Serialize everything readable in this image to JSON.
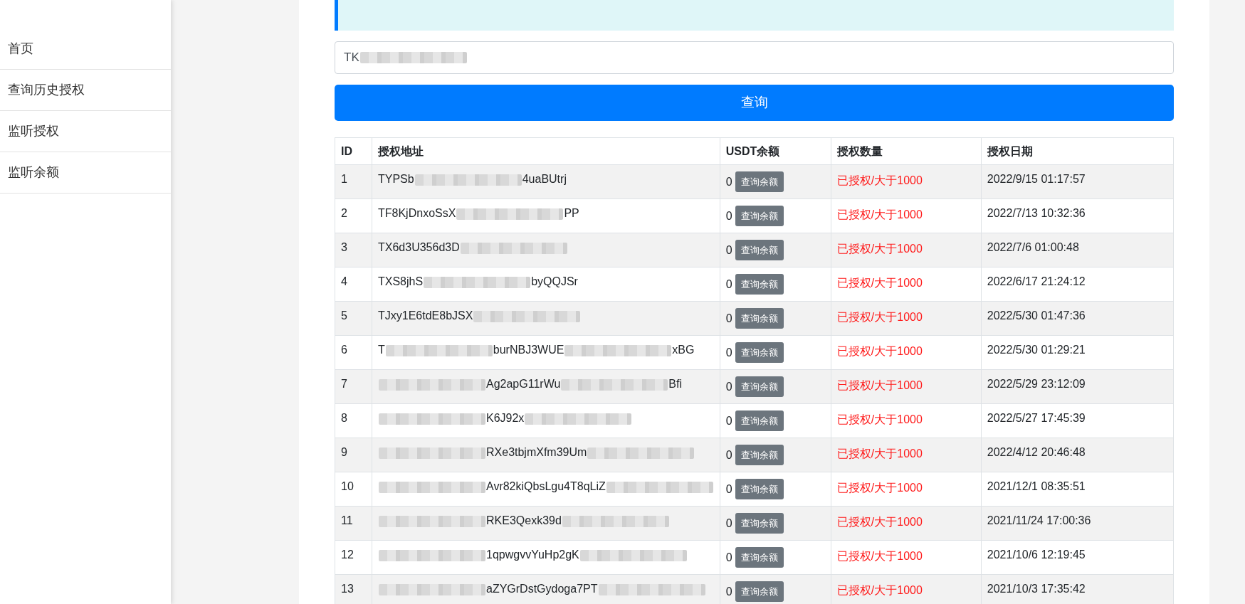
{
  "sidebar": {
    "items": [
      {
        "label": "首页"
      },
      {
        "label": "查询历史授权"
      },
      {
        "label": "监听授权"
      },
      {
        "label": "监听余额"
      }
    ]
  },
  "search": {
    "value": [
      {
        "kind": "text",
        "text": "TK"
      },
      {
        "kind": "blur"
      }
    ]
  },
  "query_button": "查询",
  "table": {
    "columns": [
      "ID",
      "授权地址",
      "USDT余额",
      "授权数量",
      "授权日期"
    ],
    "rows": [
      {
        "id": "1",
        "address": [
          {
            "kind": "text",
            "text": "TYPSb"
          },
          {
            "kind": "blur"
          },
          {
            "kind": "text",
            "text": "4uaBUtrj"
          }
        ],
        "balance": "0",
        "button": "查询余额",
        "amount": "已授权/大于1000",
        "date": "2022/9/15 01:17:57"
      },
      {
        "id": "2",
        "address": [
          {
            "kind": "text",
            "text": "TF8KjDnxoSsX"
          },
          {
            "kind": "blur"
          },
          {
            "kind": "text",
            "text": "PP"
          }
        ],
        "balance": "0",
        "button": "查询余额",
        "amount": "已授权/大于1000",
        "date": "2022/7/13 10:32:36"
      },
      {
        "id": "3",
        "address": [
          {
            "kind": "text",
            "text": "TX6d3U356d3D"
          },
          {
            "kind": "blur"
          }
        ],
        "balance": "0",
        "button": "查询余额",
        "amount": "已授权/大于1000",
        "date": "2022/7/6 01:00:48"
      },
      {
        "id": "4",
        "address": [
          {
            "kind": "text",
            "text": "TXS8jhS"
          },
          {
            "kind": "blur"
          },
          {
            "kind": "text",
            "text": "byQQJSr"
          }
        ],
        "balance": "0",
        "button": "查询余额",
        "amount": "已授权/大于1000",
        "date": "2022/6/17 21:24:12"
      },
      {
        "id": "5",
        "address": [
          {
            "kind": "text",
            "text": "TJxy1E6tdE8bJSX"
          },
          {
            "kind": "blur"
          }
        ],
        "balance": "0",
        "button": "查询余额",
        "amount": "已授权/大于1000",
        "date": "2022/5/30 01:47:36"
      },
      {
        "id": "6",
        "address": [
          {
            "kind": "text",
            "text": "T"
          },
          {
            "kind": "blur"
          },
          {
            "kind": "text",
            "text": "burNBJ3WUE"
          },
          {
            "kind": "blur"
          },
          {
            "kind": "text",
            "text": "xBG"
          }
        ],
        "balance": "0",
        "button": "查询余额",
        "amount": "已授权/大于1000",
        "date": "2022/5/30 01:29:21"
      },
      {
        "id": "7",
        "address": [
          {
            "kind": "blur"
          },
          {
            "kind": "text",
            "text": "Ag2apG11rWu"
          },
          {
            "kind": "blur"
          },
          {
            "kind": "text",
            "text": "Bfi"
          }
        ],
        "balance": "0",
        "button": "查询余额",
        "amount": "已授权/大于1000",
        "date": "2022/5/29 23:12:09"
      },
      {
        "id": "8",
        "address": [
          {
            "kind": "blur"
          },
          {
            "kind": "text",
            "text": "K6J92x"
          },
          {
            "kind": "blur"
          }
        ],
        "balance": "0",
        "button": "查询余额",
        "amount": "已授权/大于1000",
        "date": "2022/5/27 17:45:39"
      },
      {
        "id": "9",
        "address": [
          {
            "kind": "blur"
          },
          {
            "kind": "text",
            "text": "RXe3tbjmXfm39Um"
          },
          {
            "kind": "blur"
          }
        ],
        "balance": "0",
        "button": "查询余额",
        "amount": "已授权/大于1000",
        "date": "2022/4/12 20:46:48"
      },
      {
        "id": "10",
        "address": [
          {
            "kind": "blur"
          },
          {
            "kind": "text",
            "text": "Avr82kiQbsLgu4T8qLiZ"
          },
          {
            "kind": "blur"
          }
        ],
        "balance": "0",
        "button": "查询余额",
        "amount": "已授权/大于1000",
        "date": "2021/12/1 08:35:51"
      },
      {
        "id": "11",
        "address": [
          {
            "kind": "blur"
          },
          {
            "kind": "text",
            "text": "RKE3Qexk39d"
          },
          {
            "kind": "blur"
          }
        ],
        "balance": "0",
        "button": "查询余额",
        "amount": "已授权/大于1000",
        "date": "2021/11/24 17:00:36"
      },
      {
        "id": "12",
        "address": [
          {
            "kind": "blur"
          },
          {
            "kind": "text",
            "text": "1qpwgvvYuHp2gK"
          },
          {
            "kind": "blur"
          }
        ],
        "balance": "0",
        "button": "查询余额",
        "amount": "已授权/大于1000",
        "date": "2021/10/6 12:19:45"
      },
      {
        "id": "13",
        "address": [
          {
            "kind": "blur"
          },
          {
            "kind": "text",
            "text": "aZYGrDstGydoga7PT"
          },
          {
            "kind": "blur"
          }
        ],
        "balance": "0",
        "button": "查询余额",
        "amount": "已授权/大于1000",
        "date": "2021/10/3 17:35:42"
      }
    ]
  }
}
